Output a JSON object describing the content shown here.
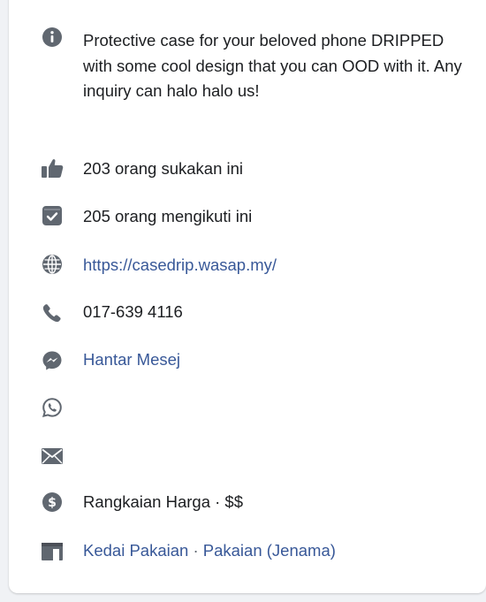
{
  "page_info": {
    "about": "Protective case for your beloved phone DRIPPED with some cool design that you can OOD with it. Any inquiry can halo halo us!",
    "likes": "203 orang sukakan ini",
    "followers": "205 orang mengikuti ini",
    "website": "https://casedrip.wasap.my/",
    "phone": "017-639 4116",
    "message": "Hantar Mesej",
    "price_range": "Rangkaian Harga · $$",
    "category_1": "Kedai Pakaian",
    "category_sep": " · ",
    "category_2": "Pakaian (Jenama)"
  },
  "icons": {
    "about": "info-icon",
    "likes": "thumbs-up-icon",
    "followers": "follow-check-icon",
    "website": "globe-icon",
    "phone": "phone-icon",
    "messenger": "messenger-icon",
    "whatsapp": "whatsapp-icon",
    "email": "envelope-icon",
    "price": "dollar-icon",
    "category": "storefront-icon"
  },
  "colors": {
    "icon_gray": "#606770",
    "text": "#1c1e21",
    "link": "#385898",
    "background": "#ffffff"
  }
}
